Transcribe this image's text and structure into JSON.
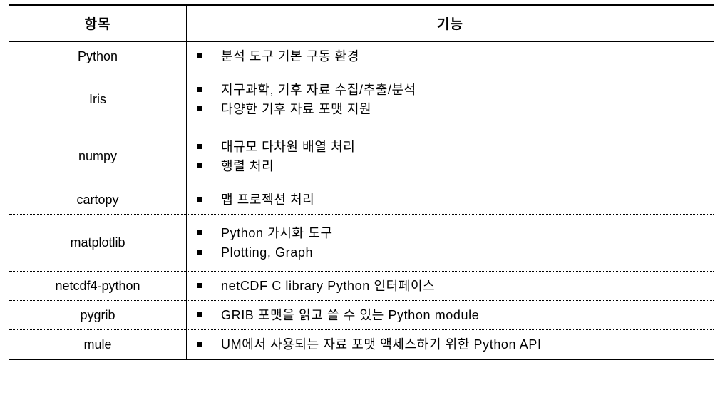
{
  "table": {
    "headers": {
      "item": "항목",
      "function": "기능"
    },
    "rows": [
      {
        "item": "Python",
        "functions": [
          "분석 도구 기본 구동 환경"
        ]
      },
      {
        "item": "Iris",
        "functions": [
          "지구과학, 기후 자료 수집/추출/분석",
          "다양한 기후 자료 포맷 지원"
        ]
      },
      {
        "item": "numpy",
        "functions": [
          "대규모 다차원 배열 처리",
          "행렬 처리"
        ]
      },
      {
        "item": "cartopy",
        "functions": [
          "맵 프로젝션 처리"
        ]
      },
      {
        "item": "matplotlib",
        "functions": [
          "Python 가시화 도구",
          "Plotting, Graph"
        ]
      },
      {
        "item": "netcdf4-python",
        "functions": [
          "netCDF C library Python 인터페이스"
        ]
      },
      {
        "item": "pygrib",
        "functions": [
          "GRIB 포맷을 읽고 쓸 수 있는 Python module"
        ]
      },
      {
        "item": "mule",
        "functions": [
          "UM에서 사용되는 자료 포맷 액세스하기 위한 Python API"
        ]
      }
    ]
  }
}
